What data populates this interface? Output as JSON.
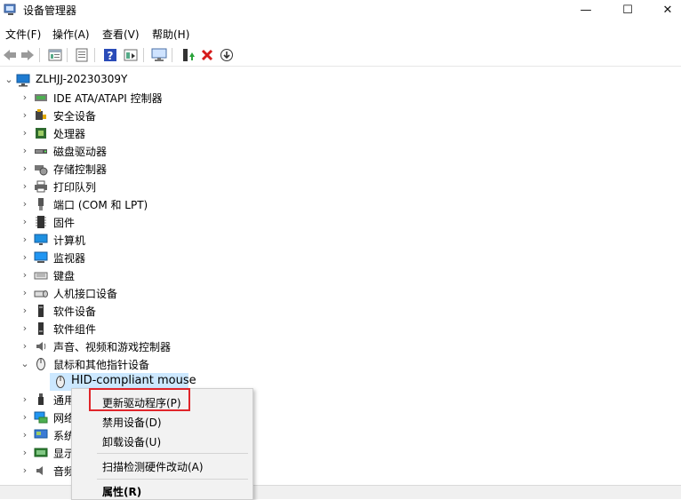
{
  "window": {
    "title": "设备管理器",
    "minimize": "—",
    "maximize": "☐",
    "close": "✕"
  },
  "menu": [
    "文件(F)",
    "操作(A)",
    "查看(V)",
    "帮助(H)"
  ],
  "toolbar_icons": [
    "back-icon",
    "forward-icon",
    "properties-icon",
    "update-icon",
    "help-icon",
    "view-icon",
    "monitor-icon",
    "enable-icon",
    "uninstall-icon",
    "download-icon"
  ],
  "tree": {
    "root": "ZLHJJ-20230309Y",
    "nodes": [
      {
        "label": "IDE ATA/ATAPI 控制器",
        "icon": "ide-icon",
        "expanded": false
      },
      {
        "label": "安全设备",
        "icon": "security-icon",
        "expanded": false
      },
      {
        "label": "处理器",
        "icon": "processor-icon",
        "expanded": false
      },
      {
        "label": "磁盘驱动器",
        "icon": "disk-icon",
        "expanded": false
      },
      {
        "label": "存储控制器",
        "icon": "storage-icon",
        "expanded": false
      },
      {
        "label": "打印队列",
        "icon": "printer-icon",
        "expanded": false
      },
      {
        "label": "端口 (COM 和 LPT)",
        "icon": "port-icon",
        "expanded": false
      },
      {
        "label": "固件",
        "icon": "firmware-icon",
        "expanded": false
      },
      {
        "label": "计算机",
        "icon": "computer-icon",
        "expanded": false
      },
      {
        "label": "监视器",
        "icon": "monitor-icon",
        "expanded": false
      },
      {
        "label": "键盘",
        "icon": "keyboard-icon",
        "expanded": false
      },
      {
        "label": "人机接口设备",
        "icon": "hid-icon",
        "expanded": false
      },
      {
        "label": "软件设备",
        "icon": "software-device-icon",
        "expanded": false
      },
      {
        "label": "软件组件",
        "icon": "software-component-icon",
        "expanded": false
      },
      {
        "label": "声音、视频和游戏控制器",
        "icon": "sound-icon",
        "expanded": false
      },
      {
        "label": "鼠标和其他指针设备",
        "icon": "mouse-icon",
        "expanded": true
      }
    ],
    "child": "HID-compliant mouse",
    "partial": [
      {
        "label": "通用",
        "icon": "usb-icon"
      },
      {
        "label": "网络",
        "icon": "network-icon"
      },
      {
        "label": "系统",
        "icon": "system-icon"
      },
      {
        "label": "显示",
        "icon": "display-icon"
      },
      {
        "label": "音频",
        "icon": "audio-icon"
      }
    ]
  },
  "context_menu": {
    "update": "更新驱动程序(P)",
    "disable": "禁用设备(D)",
    "uninstall": "卸载设备(U)",
    "scan": "扫描检测硬件改动(A)",
    "properties": "属性(R)"
  },
  "colors": {
    "highlight_border": "#e0252a",
    "selection": "#cce8ff"
  }
}
